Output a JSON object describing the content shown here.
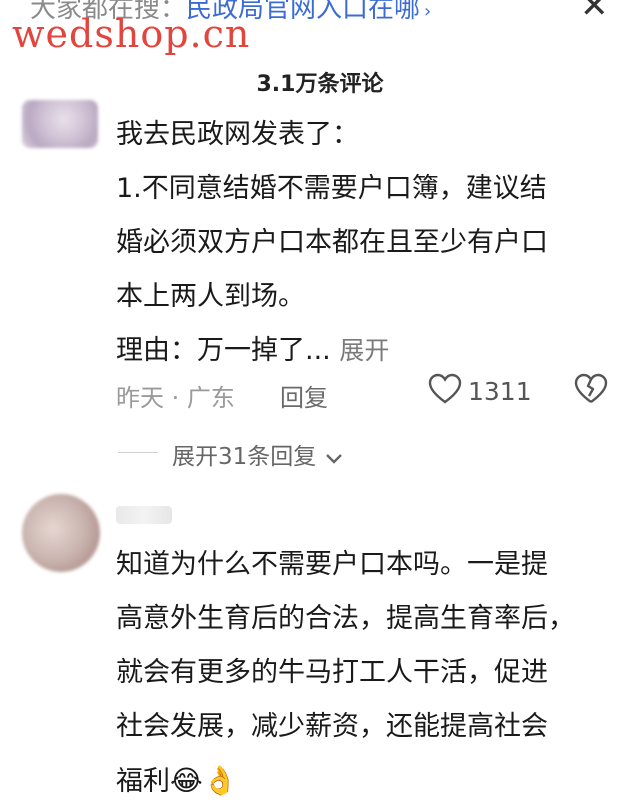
{
  "search": {
    "prefix": "大家都在搜：",
    "query": "民政局官网入口在哪",
    "chevron": "›",
    "close_glyph": "✕"
  },
  "watermark": "wedshop.cn",
  "comments_header": "3.1万条评论",
  "comments": [
    {
      "lines": [
        "我去民政网发表了：",
        "1.不同意结婚不需要户口簿，建议结",
        "婚必须双方户口本都在且至少有户口",
        "本上两人到场。"
      ],
      "last_line": "理由：万一掉了...",
      "expand_label": "展开",
      "time": "昨天 · 广东",
      "reply_label": "回复",
      "like_count": "1311",
      "expand_replies": "展开31条回复",
      "expand_chevron": "⌄"
    },
    {
      "lines": [
        "知道为什么不需要户口本吗。一是提",
        "高意外生育后的合法，提高生育率后，",
        "就会有更多的牛马打工人干活，促进",
        "社会发展，减少薪资，还能提高社会"
      ],
      "last_line": "福利",
      "emojis": "😂👌"
    }
  ],
  "icons": {
    "like": "heart-outline",
    "dislike": "broken-heart-outline",
    "close": "close",
    "chevron": "chevron-down"
  },
  "colors": {
    "link": "#3b6bd6",
    "watermark": "#e2453d",
    "meta": "#9a9a9a"
  }
}
